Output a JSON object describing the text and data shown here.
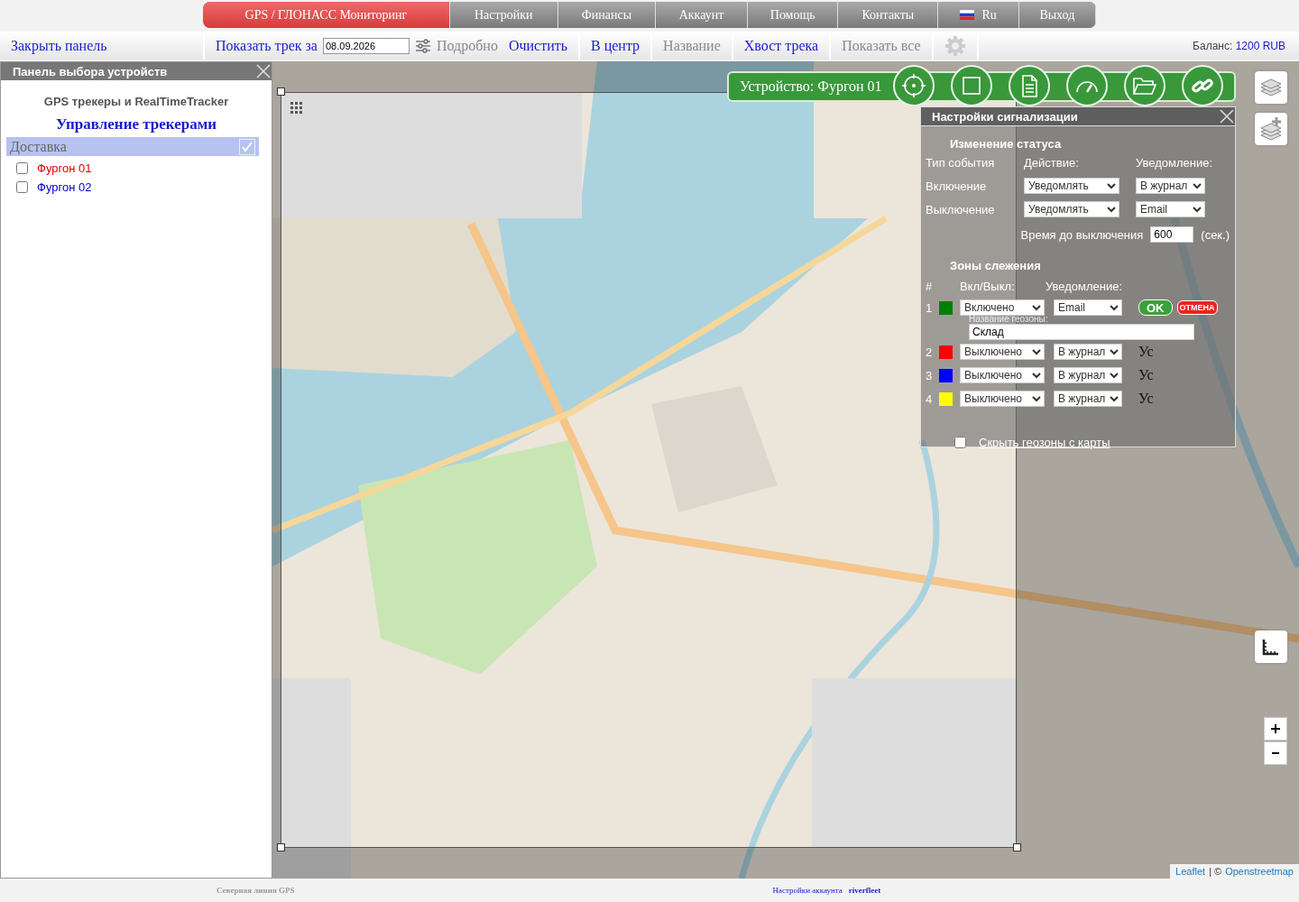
{
  "top_menu": [
    {
      "label": "GPS / ГЛОНАСС Мониторинг",
      "kind": "text",
      "selected": true
    },
    {
      "label": "Настройки",
      "kind": "text",
      "selected": false
    },
    {
      "label": "Финансы",
      "kind": "text",
      "selected": false
    },
    {
      "label": "Аккаунт",
      "kind": "text",
      "selected": false
    },
    {
      "label": "Помощь",
      "kind": "text",
      "selected": false
    },
    {
      "label": "Контакты",
      "kind": "text",
      "selected": false
    },
    {
      "label": "Ru",
      "kind": "language",
      "selected": false
    },
    {
      "label": "Выход",
      "kind": "text",
      "selected": false
    }
  ],
  "toolbar": {
    "close_panel": "Закрыть панель",
    "show_track": "Показать трек за",
    "date": "08.09.2026",
    "items": [
      {
        "label": "Подробно",
        "enabled": false
      },
      {
        "label": "Очистить",
        "enabled": true
      },
      {
        "label": "В центр",
        "enabled": true
      },
      {
        "label": "Название",
        "enabled": false
      },
      {
        "label": "Хвост трека",
        "enabled": true
      },
      {
        "label": "Показать все",
        "enabled": false
      }
    ],
    "balance_label": "Баланс:",
    "balance": "1200 RUB"
  },
  "device_panel": {
    "title": "Панель выбора устройств",
    "subtitle": "GPS трекеры и RealTimeTracker",
    "heading": "Управление трекерами",
    "groups": [
      {
        "name": "Доставка",
        "checked": true,
        "devices": [
          {
            "name": "Фургон 01",
            "checked": false,
            "color": "#e00000"
          },
          {
            "name": "Фургон 02",
            "checked": false,
            "color": "#0000cc"
          }
        ]
      }
    ]
  },
  "map": {
    "kind": "picture",
    "device_bar": "Устройство: Фургон 01",
    "attribution_links": [
      "Leaflet",
      "Openstreetmap"
    ],
    "attribution_separator": "| ©"
  },
  "alarm_settings": {
    "title": "Настройки сигнализации",
    "status_heading": "Изменение статуса",
    "columns": [
      "Тип события",
      "Действие:",
      "Уведомление:"
    ],
    "events": [
      {
        "name": "Включение",
        "action": "Уведомлять",
        "notify": "В журнал"
      },
      {
        "name": "Выключение",
        "action": "Уведомлять",
        "notify": "Email"
      }
    ],
    "timeout_label": "Время до выключения",
    "timeout": "600",
    "timeout_unit": "(сек.)",
    "zones_heading": "Зоны слежения",
    "zone_columns": [
      "#",
      "Вкл/Выкл:",
      "Уведомление:"
    ],
    "zones": [
      {
        "number": "1",
        "color": "#008000",
        "state": "Включено",
        "notify": "Email",
        "expanded": true,
        "name_label": "Название геозоны:",
        "name": "Склад",
        "ok": "OK",
        "cancel": "ОТМЕНА"
      },
      {
        "number": "2",
        "color": "#ff0000",
        "state": "Выключено",
        "notify": "В журнал",
        "expanded": false,
        "action": "Ус"
      },
      {
        "number": "3",
        "color": "#0000ff",
        "state": "Выключено",
        "notify": "В журнал",
        "expanded": false,
        "action": "Ус"
      },
      {
        "number": "4",
        "color": "#ffff00",
        "state": "Выключено",
        "notify": "В журнал",
        "expanded": false,
        "action": "Ус"
      }
    ],
    "hide_zones": {
      "label": "Скрыть геозоны с карты",
      "checked": false
    }
  },
  "footer": {
    "brand": "Северная линия GPS",
    "link": "Настройки аккаунта",
    "user": "riverfleet"
  }
}
